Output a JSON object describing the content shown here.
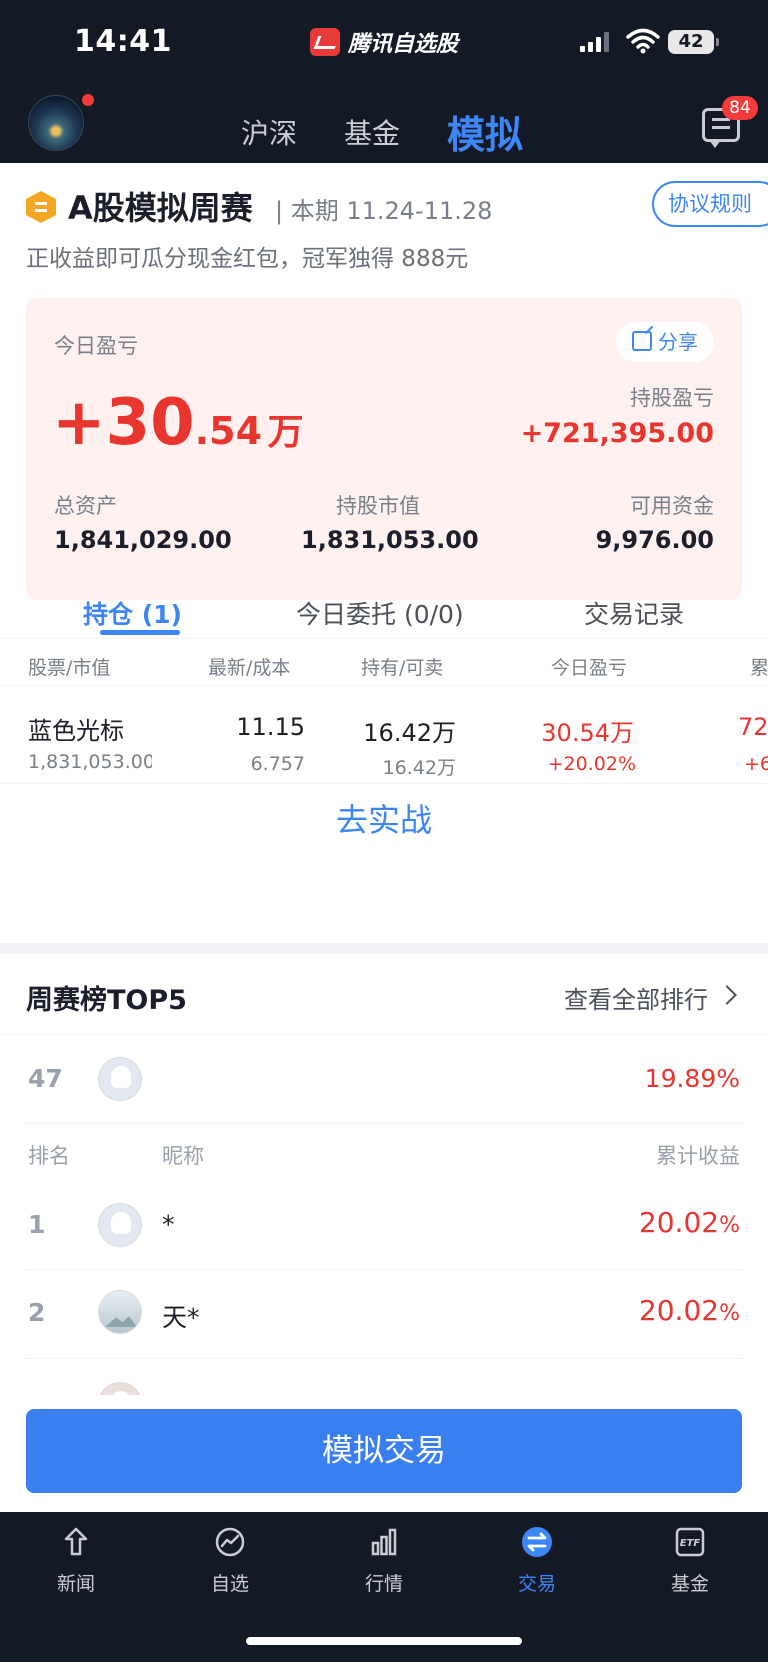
{
  "status": {
    "time": "14:41",
    "app_name": "腾讯自选股",
    "battery": "42"
  },
  "header": {
    "tabs": [
      {
        "label": "沪深"
      },
      {
        "label": "基金"
      },
      {
        "label": "模拟"
      }
    ],
    "message_count": "84"
  },
  "contest": {
    "title": "A股模拟周赛",
    "period": "| 本期 11.24-11.28",
    "rules_button": "协议规则",
    "subtitle": "正收益即可瓜分现金红包，冠军独得 888元"
  },
  "pnl": {
    "today_label": "今日盈亏",
    "share_label": "分享",
    "today_int": "+30",
    "today_dec": ".54",
    "today_unit": "万",
    "holding_label": "持股盈亏",
    "holding_value": "+721,395.00",
    "stats": [
      {
        "label": "总资产",
        "value": "1,841,029.00"
      },
      {
        "label": "持股市值",
        "value": "1,831,053.00"
      },
      {
        "label": "可用资金",
        "value": "9,976.00"
      }
    ]
  },
  "tabs": [
    {
      "label": "持仓 (1)"
    },
    {
      "label": "今日委托 (0/0)"
    },
    {
      "label": "交易记录"
    }
  ],
  "table": {
    "headers": [
      "股票/市值",
      "最新/成本",
      "持有/可卖",
      "今日盈亏",
      "累"
    ],
    "row": {
      "name": "蓝色光标",
      "market_value": "1,831,053.00",
      "latest": "11.15",
      "cost": "6.757",
      "hold": "16.42万",
      "sellable": "16.42万",
      "today_pnl": "30.54万",
      "today_pct": "+20.02%",
      "total_pnl": "72",
      "total_pct": "+6"
    }
  },
  "go_real": "去实战",
  "board": {
    "title": "周赛榜TOP5",
    "view_all": "查看全部排行",
    "mine": {
      "rank": "47",
      "pct": "19.89%"
    },
    "headers": {
      "rank": "排名",
      "nick": "昵称",
      "gain": "累计收益"
    },
    "rows": [
      {
        "rank": "1",
        "name": "*",
        "pct_num": "20.02",
        "pct_sign": "%"
      },
      {
        "rank": "2",
        "name": "天*",
        "pct_num": "20.02",
        "pct_sign": "%"
      }
    ]
  },
  "cta": "模拟交易",
  "bottom_nav": [
    {
      "label": "新闻",
      "icon": "news-icon"
    },
    {
      "label": "自选",
      "icon": "watchlist-icon"
    },
    {
      "label": "行情",
      "icon": "market-icon"
    },
    {
      "label": "交易",
      "icon": "trade-icon"
    },
    {
      "label": "基金",
      "icon": "etf-icon"
    }
  ],
  "colors": {
    "accent": "#3d86f6",
    "gain": "#e8362f",
    "dark": "#141a25"
  }
}
